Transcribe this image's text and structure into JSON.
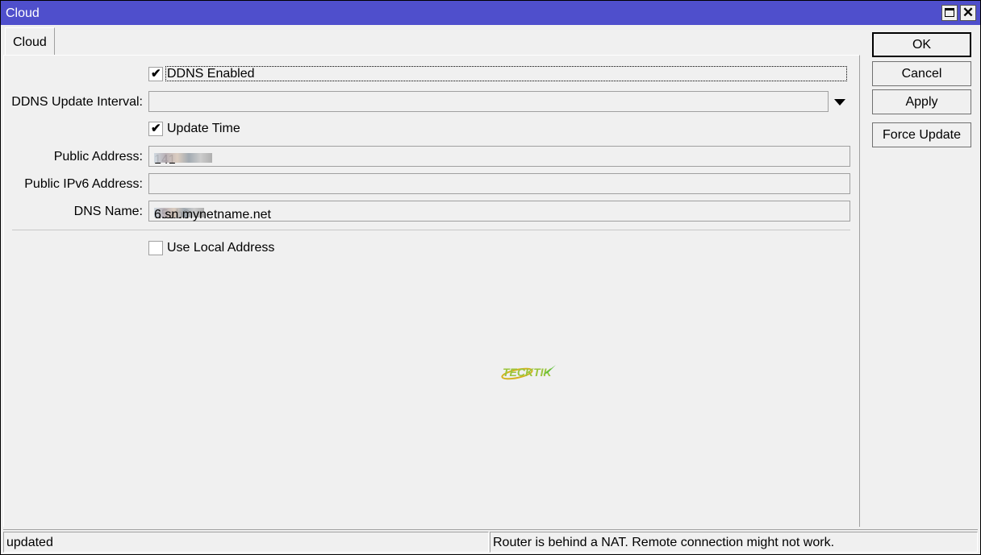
{
  "window": {
    "title": "Cloud",
    "maximize_icon": "maximize-icon",
    "close_icon": "close-icon",
    "close_glyph": "✕"
  },
  "tabs": [
    {
      "label": "Cloud",
      "active": true
    }
  ],
  "form": {
    "ddns_enabled": {
      "label": "DDNS Enabled",
      "checked": true,
      "check_glyph": "✔"
    },
    "ddns_update_interval": {
      "label": "DDNS Update Interval:",
      "value": ""
    },
    "update_time": {
      "label": "Update Time",
      "checked": true,
      "check_glyph": "✔"
    },
    "public_address": {
      "label": "Public Address:",
      "value_visible": "141",
      "value_redacted": true
    },
    "public_ipv6_address": {
      "label": "Public IPv6 Address:",
      "value": ""
    },
    "dns_name": {
      "label": "DNS Name:",
      "value_prefix": "d5ab0",
      "value_suffix": "6.sn.mynetname.net",
      "value_redacted": true
    },
    "use_local_address": {
      "label": "Use Local Address",
      "checked": false
    }
  },
  "buttons": {
    "ok": "OK",
    "cancel": "Cancel",
    "apply": "Apply",
    "force_update": "Force Update"
  },
  "watermark": {
    "text": "TECKTIK",
    "colors": [
      "#9bc53d",
      "#d4b21f",
      "#5cbf3a"
    ]
  },
  "statusbar": {
    "left": "updated",
    "right": "Router is behind a NAT. Remote connection might not work."
  },
  "colors": {
    "titlebar": "#4f4fcc",
    "background": "#f0f0f0"
  }
}
